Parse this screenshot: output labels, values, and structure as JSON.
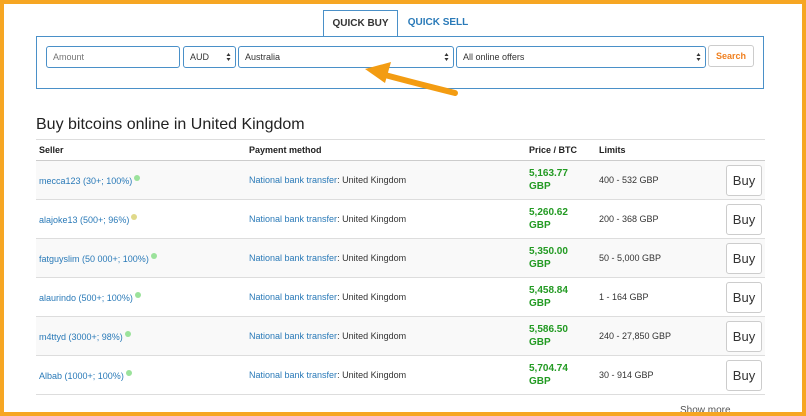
{
  "tabs": [
    {
      "label": "QUICK BUY",
      "active": true
    },
    {
      "label": "QUICK SELL",
      "active": false
    }
  ],
  "search_form": {
    "amount_placeholder": "Amount",
    "currency": "AUD",
    "country": "Australia",
    "offers_filter": "All online offers",
    "search_label": "Search"
  },
  "heading": "Buy bitcoins online in United Kingdom",
  "table": {
    "columns": [
      "Seller",
      "Payment method",
      "Price / BTC",
      "Limits",
      ""
    ],
    "rows": [
      {
        "seller": "mecca123 (30+; 100%)",
        "status": "#9be29b",
        "method": "National bank transfer",
        "country": ": United Kingdom",
        "price": "5,163.77",
        "currency": "GBP",
        "limits": "400 - 532 GBP",
        "action": "Buy"
      },
      {
        "seller": "alajoke13 (500+; 96%)",
        "status": "#e0d98a",
        "method": "National bank transfer",
        "country": ": United Kingdom",
        "price": "5,260.62",
        "currency": "GBP",
        "limits": "200 - 368 GBP",
        "action": "Buy"
      },
      {
        "seller": "fatguyslim (50 000+; 100%)",
        "status": "#9be29b",
        "method": "National bank transfer",
        "country": ": United Kingdom",
        "price": "5,350.00",
        "currency": "GBP",
        "limits": "50 - 5,000 GBP",
        "action": "Buy"
      },
      {
        "seller": "alaurindo (500+; 100%)",
        "status": "#9be29b",
        "method": "National bank transfer",
        "country": ": United Kingdom",
        "price": "5,458.84",
        "currency": "GBP",
        "limits": "1 - 164 GBP",
        "action": "Buy"
      },
      {
        "seller": "m4ttyd (3000+; 98%)",
        "status": "#9be29b",
        "method": "National bank transfer",
        "country": ": United Kingdom",
        "price": "5,586.50",
        "currency": "GBP",
        "limits": "240 - 27,850 GBP",
        "action": "Buy"
      },
      {
        "seller": "Albab (1000+; 100%)",
        "status": "#9be29b",
        "method": "National bank transfer",
        "country": ": United Kingdom",
        "price": "5,704.74",
        "currency": "GBP",
        "limits": "30 - 914 GBP",
        "action": "Buy"
      }
    ]
  },
  "show_more": "Show more",
  "colors": {
    "accent": "#2a7ab8",
    "price": "#229a22",
    "frame": "#f6a623",
    "arrow": "#f39c12"
  },
  "icons": {
    "annotation": "arrow-icon",
    "select": "select-arrows-icon"
  }
}
